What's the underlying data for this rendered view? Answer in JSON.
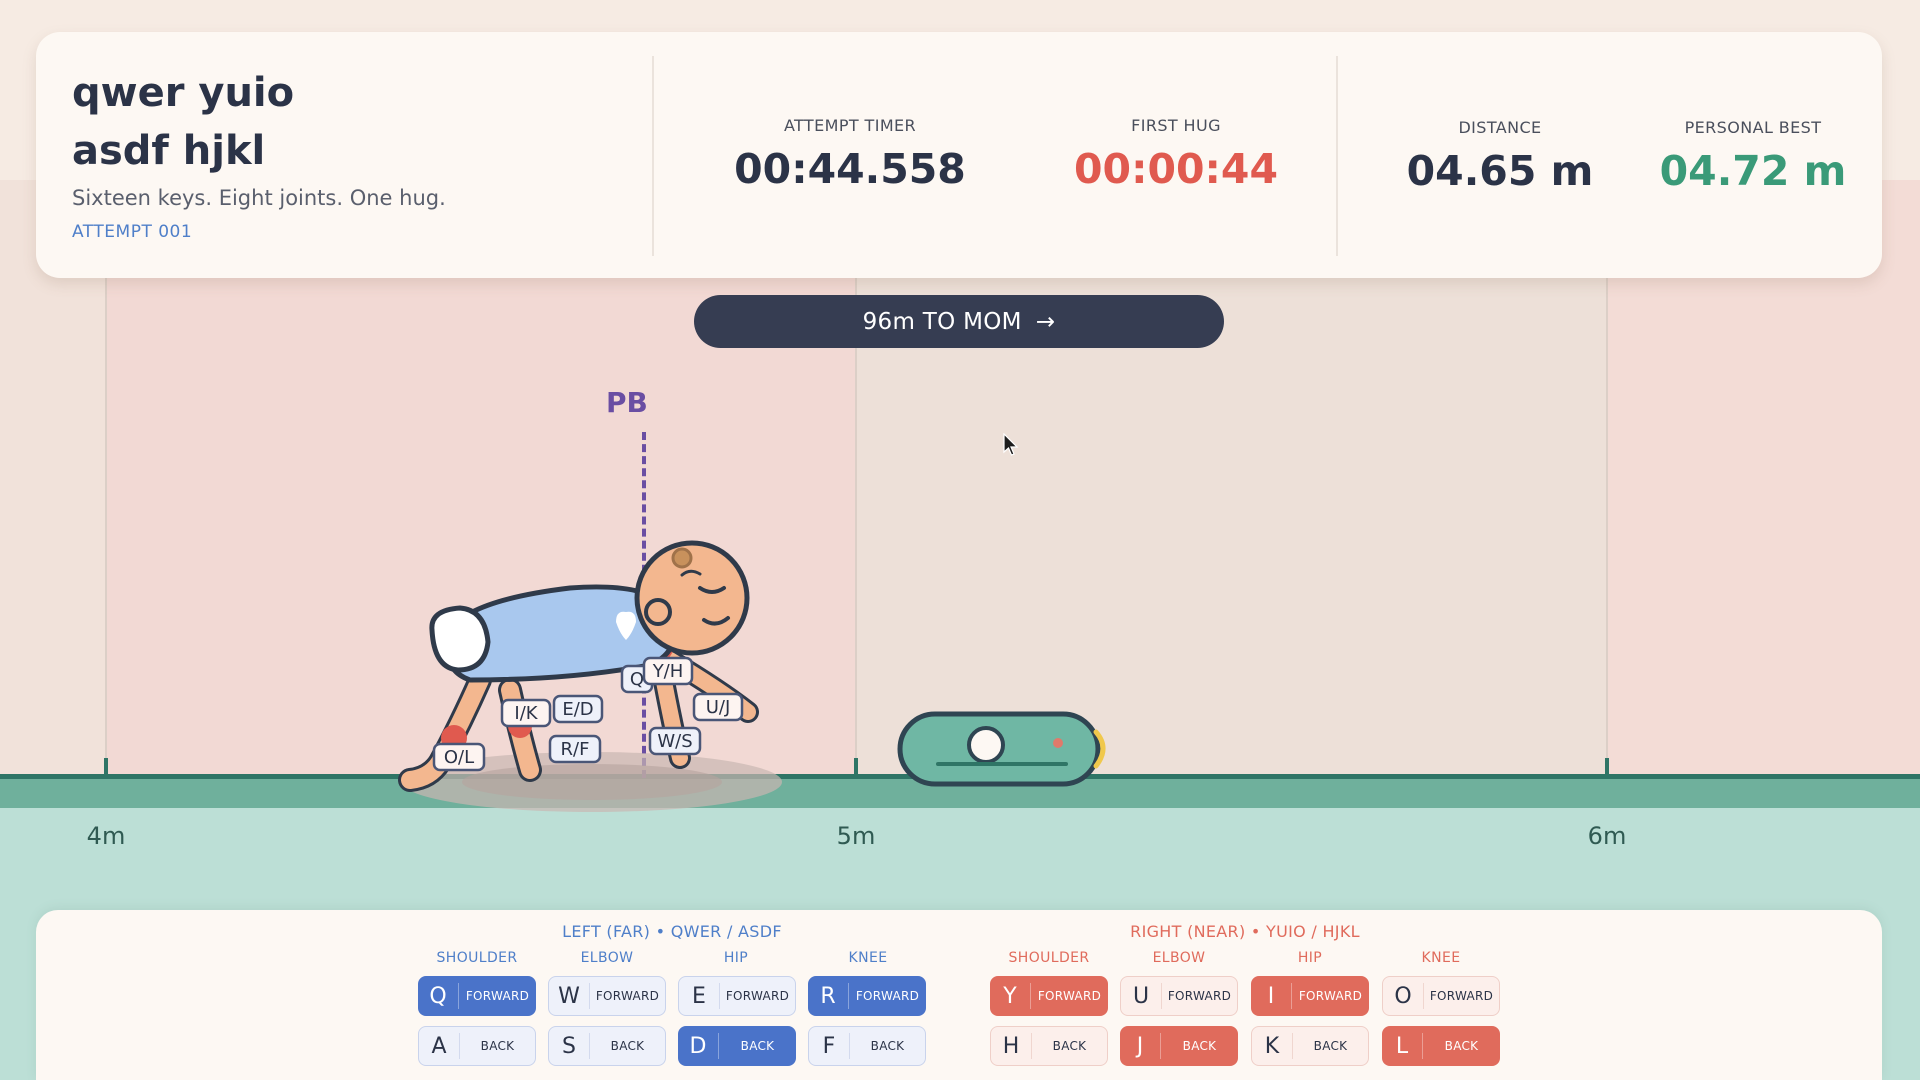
{
  "header": {
    "title_line1": "qwer yuio",
    "title_line2": "asdf hjkl",
    "tagline": "Sixteen keys. Eight joints. One hug.",
    "attempt": "ATTEMPT  001",
    "attempt_timer_label": "ATTEMPT TIMER",
    "attempt_timer_value": "00:44.558",
    "first_hug_label": "FIRST HUG",
    "first_hug_value": "00:00:44",
    "distance_label": "DISTANCE",
    "distance_value": "04.65 m",
    "personal_best_label": "PERSONAL BEST",
    "personal_best_value": "04.72 m"
  },
  "banner": {
    "text": "96m TO MOM",
    "arrow": "→"
  },
  "track": {
    "pb_label": "PB",
    "distance_markers": [
      "4m",
      "5m",
      "6m"
    ]
  },
  "baby_key_tags": [
    "Q",
    "Y/H",
    "I/K",
    "E/D",
    "U/J",
    "W/S",
    "R/F",
    "O/L"
  ],
  "controls": {
    "left_title": "LEFT (FAR)  •  QWER / ASDF",
    "right_title": "RIGHT (NEAR)  •  YUIO / HJKL",
    "left_joints": [
      {
        "name": "SHOULDER",
        "forward_key": "Q",
        "back_key": "A",
        "forward_active": true,
        "back_active": false
      },
      {
        "name": "ELBOW",
        "forward_key": "W",
        "back_key": "S",
        "forward_active": false,
        "back_active": false
      },
      {
        "name": "HIP",
        "forward_key": "E",
        "back_key": "D",
        "forward_active": false,
        "back_active": true
      },
      {
        "name": "KNEE",
        "forward_key": "R",
        "back_key": "F",
        "forward_active": true,
        "back_active": false
      }
    ],
    "right_joints": [
      {
        "name": "SHOULDER",
        "forward_key": "Y",
        "back_key": "H",
        "forward_active": true,
        "back_active": false
      },
      {
        "name": "ELBOW",
        "forward_key": "U",
        "back_key": "J",
        "forward_active": false,
        "back_active": true
      },
      {
        "name": "HIP",
        "forward_key": "I",
        "back_key": "K",
        "forward_active": true,
        "back_active": false
      },
      {
        "name": "KNEE",
        "forward_key": "O",
        "back_key": "L",
        "forward_active": false,
        "back_active": true
      }
    ],
    "forward_label": "FORWARD",
    "back_label": "BACK"
  },
  "colors": {
    "accent_blue": "#4a73c9",
    "accent_red": "#e06b5c",
    "best_green": "#3a9a78",
    "hug_red": "#e05a4f",
    "pb_purple": "#6a4ea3"
  }
}
